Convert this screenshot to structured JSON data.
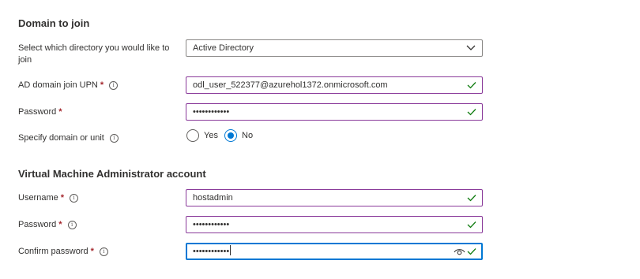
{
  "domain_section": {
    "title": "Domain to join",
    "directory": {
      "label": "Select which directory you would like to join",
      "value": "Active Directory"
    },
    "upn": {
      "label": "AD domain join UPN",
      "value": "odl_user_522377@azurehol1372.onmicrosoft.com"
    },
    "password": {
      "label": "Password",
      "value": "••••••••••••"
    },
    "specify": {
      "label": "Specify domain or unit",
      "options": [
        "Yes",
        "No"
      ],
      "selected": "No"
    }
  },
  "vm_admin_section": {
    "title": "Virtual Machine Administrator account",
    "username": {
      "label": "Username",
      "value": "hostadmin"
    },
    "password": {
      "label": "Password",
      "value": "••••••••••••"
    },
    "confirm_password": {
      "label": "Confirm password",
      "value": "••••••••••••"
    }
  },
  "required_marker": "*",
  "info_glyph": "i",
  "colors": {
    "required": "#a4262c",
    "valid_border": "#8a3a9a",
    "valid_check": "#107c10",
    "focus": "#0078d4"
  },
  "icons": {
    "info": "info-icon",
    "check": "check-icon",
    "chevron": "chevron-down-icon",
    "eye": "eye-icon"
  }
}
